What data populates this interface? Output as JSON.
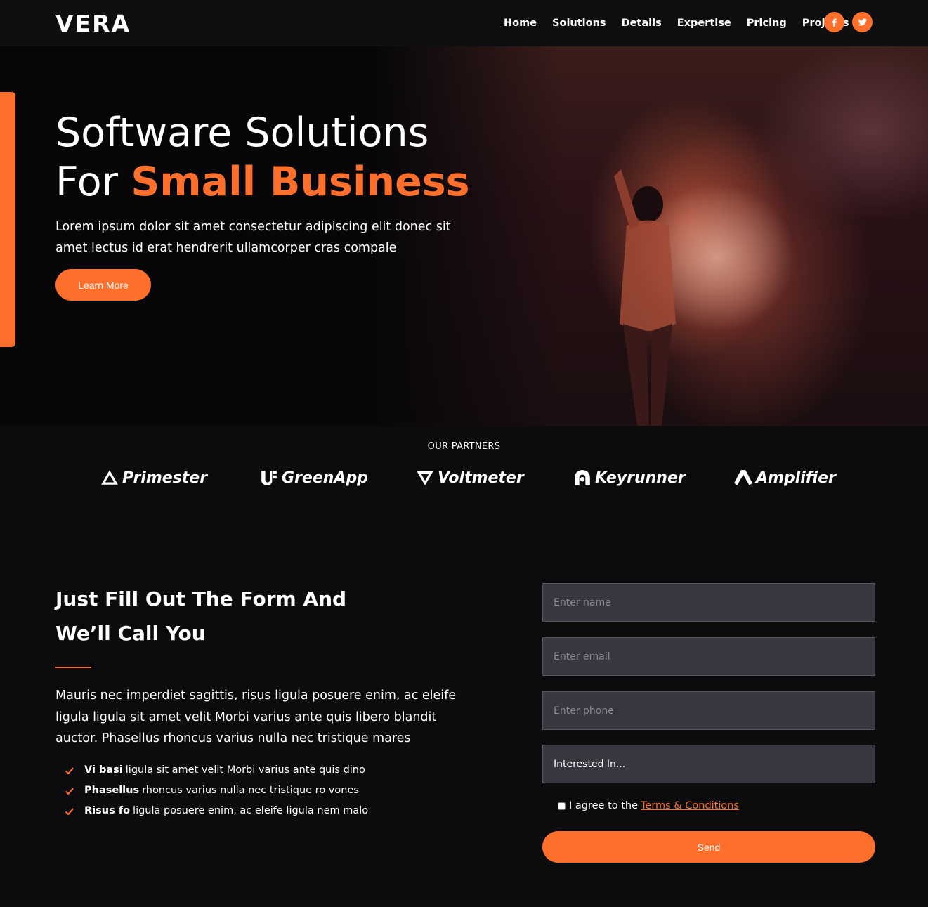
{
  "brand": {
    "logo": "VERA"
  },
  "nav": {
    "links": [
      "Home",
      "Solutions",
      "Details",
      "Expertise",
      "Pricing",
      "Projects"
    ],
    "social": [
      "facebook-icon",
      "twitter-icon"
    ]
  },
  "hero": {
    "title_line1": "Software Solutions",
    "title_line2_prefix": "For ",
    "title_line2_highlight": "Small Business",
    "text": "Lorem ipsum dolor sit amet consectetur adipiscing elit donec sit amet lectus id erat hendrerit ullamcorper cras compale",
    "button": "Learn More"
  },
  "partners": {
    "title": "OUR PARTNERS",
    "items": [
      "Primester",
      "GreenApp",
      "Voltmeter",
      "Keyrunner",
      "Amplifier"
    ]
  },
  "contact": {
    "title": "Just Fill Out The Form And We’ll Call You",
    "description": "Mauris nec imperdiet sagittis, risus ligula posuere enim, ac eleife ligula ligula sit amet velit Morbi varius ante quis libero blandit auctor. Phasellus rhoncus varius nulla nec tristique mares",
    "bullets": [
      {
        "bold": "Vi basi",
        "text": "ligula sit amet velit Morbi varius ante quis dino"
      },
      {
        "bold": "Phasellus",
        "text": "rhoncus varius nulla nec tristique ro vones"
      },
      {
        "bold": "Risus fo",
        "text": "ligula posuere enim, ac eleife ligula nem malo"
      }
    ],
    "form": {
      "name_placeholder": "Enter name",
      "email_placeholder": "Enter email",
      "phone_placeholder": "Enter phone",
      "select_value": "Interested In...",
      "agree_text": "I agree to the",
      "agree_link": "Terms & Conditions",
      "send": "Send"
    }
  },
  "colors": {
    "accent": "#fd6f2b",
    "background": "#0c0c0f",
    "field": "#37373f"
  }
}
